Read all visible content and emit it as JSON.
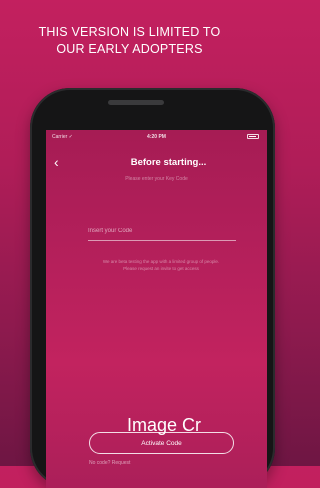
{
  "headline": {
    "line1": "THIS VERSION IS LIMITED TO",
    "line2": "OUR EARLY ADOPTERS"
  },
  "phone": {
    "status": {
      "carrier": "Carrier ✓",
      "time": "4:20 PM"
    },
    "nav": {
      "back_icon": "chevron-left-icon",
      "title": "Before starting..."
    },
    "subtitle": "Please enter your Key Code",
    "code_input": {
      "placeholder": "Insert your Code",
      "value": ""
    },
    "help_text": "We are beta testing the app with a limited group of people. Please request an invite to get access",
    "activate_label": "Activate Code",
    "footer_link": "No code? Request"
  },
  "watermark": "Image Cr",
  "colors": {
    "background_top": "#c3205f",
    "background_bottom": "#6e1643",
    "phone_body": "#151516",
    "text": "#ffffff"
  }
}
